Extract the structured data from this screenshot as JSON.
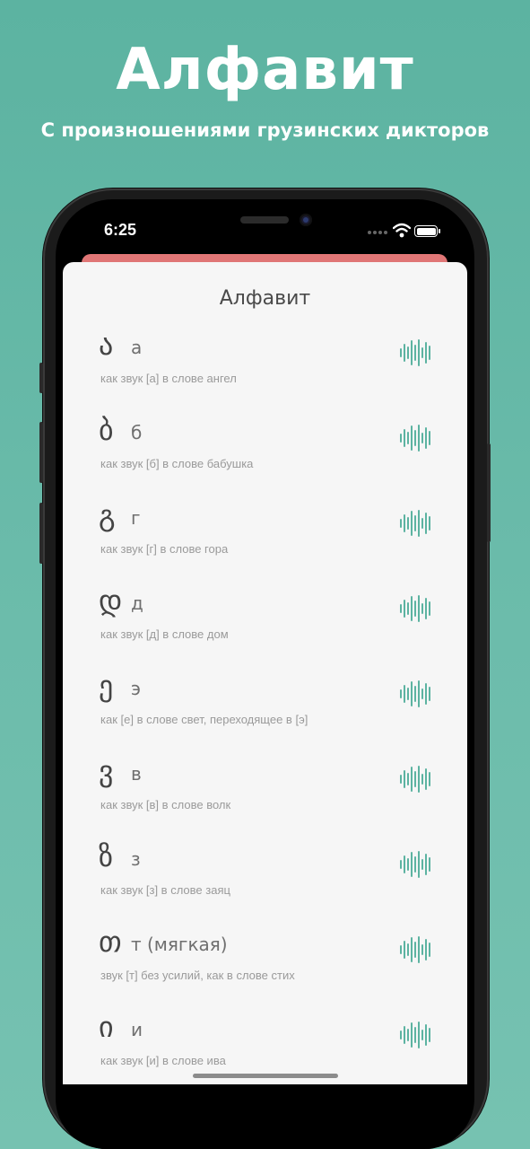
{
  "promo": {
    "title": "Алфавит",
    "subtitle": "С произношениями грузинских дикторов"
  },
  "status_bar": {
    "time": "6:25"
  },
  "screen": {
    "title": "Алфавит",
    "letters": [
      {
        "glyph": "ა",
        "translit": "а",
        "hint": "как звук [а] в слове ангел"
      },
      {
        "glyph": "ბ",
        "translit": "б",
        "hint": "как звук [б] в слове бабушка"
      },
      {
        "glyph": "გ",
        "translit": "г",
        "hint": "как звук [г] в слове гора"
      },
      {
        "glyph": "დ",
        "translit": "д",
        "hint": "как звук [д] в слове дом"
      },
      {
        "glyph": "ე",
        "translit": "э",
        "hint": "как [е] в слове свет, переходящее в [э]"
      },
      {
        "glyph": "ვ",
        "translit": "в",
        "hint": "как звук [в] в слове волк"
      },
      {
        "glyph": "ზ",
        "translit": "з",
        "hint": "как звук [з] в слове заяц"
      },
      {
        "glyph": "თ",
        "translit": "т (мягкая)",
        "hint": "звук [т] без усилий, как в слове стих"
      },
      {
        "glyph": "ი",
        "translit": "и",
        "hint": "как звук [и] в слове ива"
      }
    ]
  },
  "colors": {
    "background": "#5cb3a1",
    "accent_wave": "#5cb3a1",
    "back_sheet": "#e07676",
    "sheet": "#f6f6f6"
  },
  "icons": {
    "audio": "sound-wave-icon",
    "wifi": "wifi-icon",
    "battery": "battery-icon"
  }
}
